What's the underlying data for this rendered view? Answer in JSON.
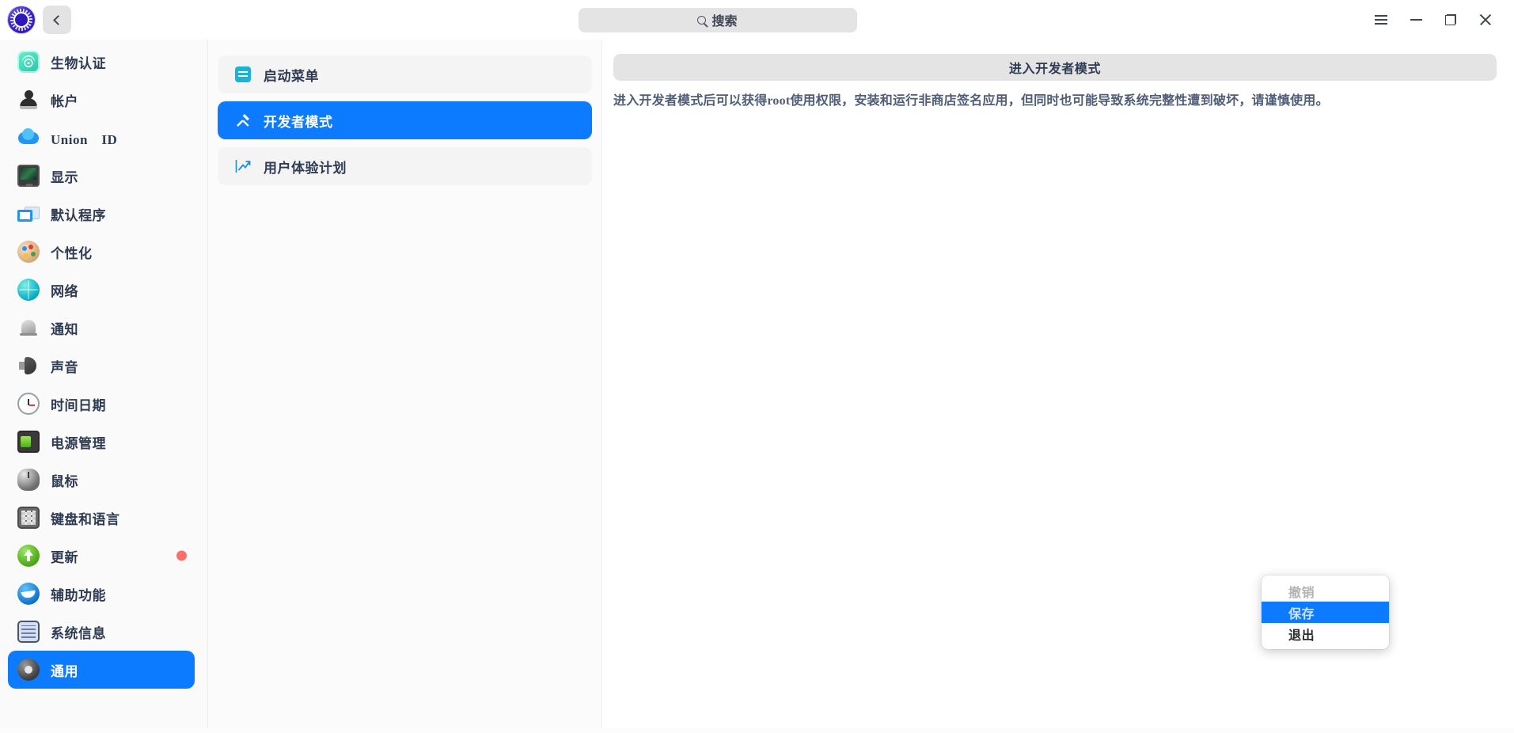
{
  "titlebar": {
    "logo_icon": "uos-logo-icon",
    "back_icon": "chevron-left-icon",
    "search_placeholder": "搜索",
    "search_icon": "search-icon",
    "window_buttons": [
      {
        "name": "menu-button",
        "icon": "hamburger-icon"
      },
      {
        "name": "minimize-button",
        "icon": "minimize-icon"
      },
      {
        "name": "restore-button",
        "icon": "restore-icon"
      },
      {
        "name": "close-button",
        "icon": "close-icon"
      }
    ]
  },
  "sidebar": {
    "items": [
      {
        "label": "生物认证",
        "icon": "fingerprint-icon",
        "icon_class": "ic-fingerprint",
        "selected": false,
        "badge": false
      },
      {
        "label": "帐户",
        "icon": "account-icon",
        "icon_class": "ic-account",
        "selected": false,
        "badge": false
      },
      {
        "label": "Union　ID",
        "icon": "cloud-icon",
        "icon_class": "ic-cloud",
        "selected": false,
        "badge": false
      },
      {
        "label": "显示",
        "icon": "monitor-icon",
        "icon_class": "ic-monitor",
        "selected": false,
        "badge": false
      },
      {
        "label": "默认程序",
        "icon": "default-apps-icon",
        "icon_class": "ic-default",
        "selected": false,
        "badge": false
      },
      {
        "label": "个性化",
        "icon": "palette-icon",
        "icon_class": "ic-palette",
        "selected": false,
        "badge": false
      },
      {
        "label": "网络",
        "icon": "globe-icon",
        "icon_class": "ic-network",
        "selected": false,
        "badge": false
      },
      {
        "label": "通知",
        "icon": "bell-icon",
        "icon_class": "ic-bell",
        "selected": false,
        "badge": false
      },
      {
        "label": "声音",
        "icon": "speaker-icon",
        "icon_class": "ic-speaker",
        "selected": false,
        "badge": false
      },
      {
        "label": "时间日期",
        "icon": "clock-icon",
        "icon_class": "ic-clock",
        "selected": false,
        "badge": false
      },
      {
        "label": "电源管理",
        "icon": "battery-icon",
        "icon_class": "ic-battery",
        "selected": false,
        "badge": false
      },
      {
        "label": "鼠标",
        "icon": "mouse-icon",
        "icon_class": "ic-mouse",
        "selected": false,
        "badge": false
      },
      {
        "label": "键盘和语言",
        "icon": "keyboard-icon",
        "icon_class": "ic-keyboard",
        "selected": false,
        "badge": false
      },
      {
        "label": "更新",
        "icon": "update-arrow-icon",
        "icon_class": "ic-update",
        "selected": false,
        "badge": true
      },
      {
        "label": "辅助功能",
        "icon": "accessibility-icon",
        "icon_class": "ic-access",
        "selected": false,
        "badge": false
      },
      {
        "label": "系统信息",
        "icon": "system-info-icon",
        "icon_class": "ic-sysinfo",
        "selected": false,
        "badge": false
      },
      {
        "label": "通用",
        "icon": "gear-icon",
        "icon_class": "ic-gear",
        "selected": true,
        "badge": false
      }
    ],
    "badge_color": "#fc6d6d",
    "selected_color": "#0d7bff"
  },
  "midpanel": {
    "items": [
      {
        "label": "启动菜单",
        "icon": "start-menu-icon",
        "selected": false
      },
      {
        "label": "开发者模式",
        "icon": "hammer-tools-icon",
        "selected": true
      },
      {
        "label": "用户体验计划",
        "icon": "trend-up-icon",
        "selected": false
      }
    ]
  },
  "content": {
    "enter_dev_button": "进入开发者模式",
    "description": "进入开发者模式后可以获得root使用权限，安装和运行非商店签名应用，但同时也可能导致系统完整性遭到破坏，请谨慎使用。"
  },
  "context_menu": {
    "items": [
      {
        "label": "撤销",
        "state": "disabled"
      },
      {
        "label": "保存",
        "state": "highlighted"
      },
      {
        "label": "退出",
        "state": "enabled"
      }
    ]
  }
}
